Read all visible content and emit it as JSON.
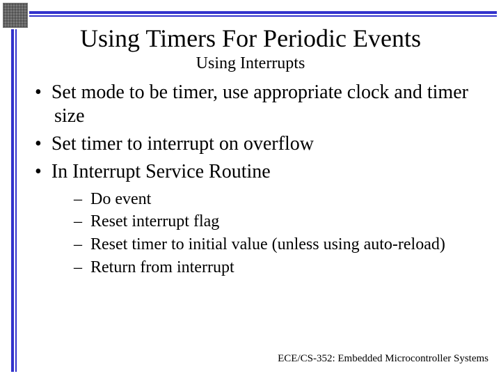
{
  "slide": {
    "title": "Using Timers For Periodic Events",
    "subtitle": "Using Interrupts",
    "bullets": [
      {
        "text": "Set mode to be timer, use appropriate clock and timer size"
      },
      {
        "text": "Set timer to interrupt on overflow"
      },
      {
        "text": "In Interrupt Service Routine",
        "sub": [
          "Do event",
          "Reset interrupt flag",
          "Reset timer to initial value (unless using auto-reload)",
          "Return from interrupt"
        ]
      }
    ],
    "footer": "ECE/CS-352: Embedded Microcontroller Systems"
  },
  "theme": {
    "accent": "#3232cc"
  }
}
